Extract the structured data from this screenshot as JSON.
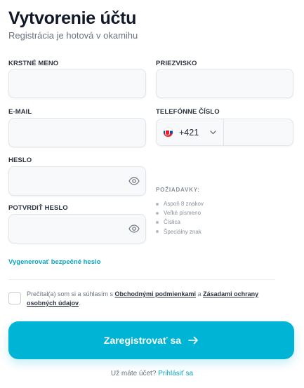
{
  "header": {
    "title": "Vytvorenie účtu",
    "subtitle": "Registrácia je hotová v okamihu"
  },
  "form": {
    "first_name_label": "KRSTNÉ MENO",
    "first_name_value": "",
    "last_name_label": "PRIEZVISKO",
    "last_name_value": "",
    "email_label": "E-MAIL",
    "email_value": "",
    "phone_label": "TELEFÓNNE ČÍSLO",
    "phone_country_code": "+421",
    "phone_country": "slovakia-flag",
    "phone_value": "",
    "password_label": "HESLO",
    "password_value": "",
    "confirm_password_label": "POTVRDIŤ HESLO",
    "confirm_password_value": ""
  },
  "requirements": {
    "title": "POŽIADAVKY:",
    "items": [
      "Aspoň 8 znakov",
      "Veľké písmeno",
      "Číslica",
      "Špeciálny znak"
    ]
  },
  "generate_link": "Vygenerovať bezpečné heslo",
  "terms": {
    "prefix": "Prečítal(a) som si a súhlasím s ",
    "link1": "Obchodnými podmienkami",
    "middle": " a ",
    "link2": "Zásadami ochrany osobných údajov",
    "suffix": ".",
    "checked": false
  },
  "submit_label": "Zaregistrovať sa",
  "login": {
    "question": "Už máte účet?",
    "link": "Prihlásiť sa"
  },
  "colors": {
    "accent": "#00b4d6",
    "link": "#0aa5c4",
    "field_bg": "#f8f9fb",
    "field_border": "#e2e5ea"
  },
  "icons": [
    "eye-icon",
    "chevron-down-icon",
    "arrow-right-icon",
    "slovakia-flag-icon"
  ]
}
